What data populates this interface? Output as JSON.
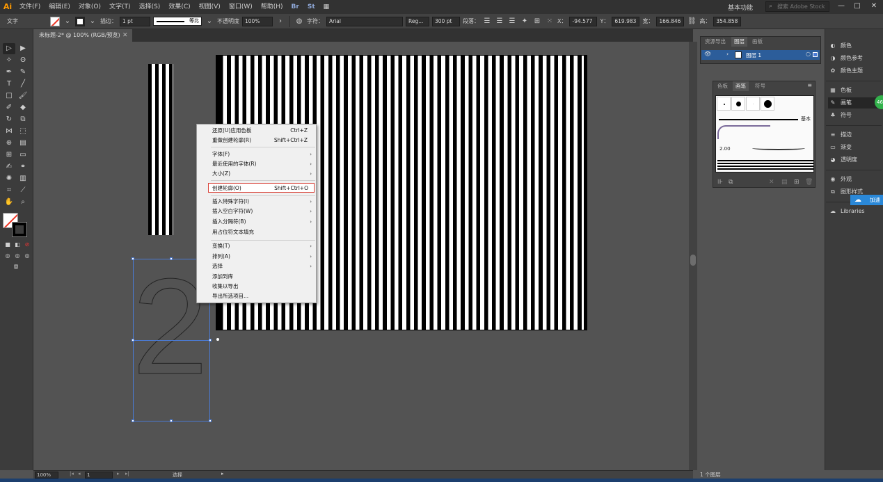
{
  "app": {
    "logo": "Ai"
  },
  "menubar": {
    "items": [
      "文件(F)",
      "编辑(E)",
      "对象(O)",
      "文字(T)",
      "选择(S)",
      "效果(C)",
      "视图(V)",
      "窗口(W)",
      "帮助(H)"
    ],
    "workspace": "基本功能",
    "stock_search_placeholder": "搜索 Adobe Stock",
    "window_buttons": [
      "—",
      "□",
      "✕"
    ]
  },
  "controlbar": {
    "tool_label": "文字",
    "stroke_label": "描边：",
    "stroke_weight": "1 pt",
    "stroke_profile": "等比",
    "opacity_label": "不透明度",
    "opacity_value": "100%",
    "char_label": "字符：",
    "font_family": "Arial",
    "font_style": "Reg...",
    "font_size": "300 pt",
    "para_label": "段落：",
    "x_label": "X：",
    "x_value": "-94.577",
    "y_label": "Y：",
    "y_value": "619.983",
    "w_label": "宽：",
    "w_value": "166.846",
    "h_label": "高：",
    "h_value": "354.858"
  },
  "document": {
    "tab_title": "未标题-2* @ 100% (RGB/预览)",
    "glyph": "2"
  },
  "context_menu": {
    "items": [
      {
        "label": "还原(U)应用色板",
        "shortcut": "Ctrl+Z"
      },
      {
        "label": "重做创建轮廓(R)",
        "shortcut": "Shift+Ctrl+Z"
      },
      {
        "label": "字体(F)",
        "submenu": "›"
      },
      {
        "label": "最近使用的字体(R)",
        "submenu": "›"
      },
      {
        "label": "大小(Z)",
        "submenu": "›"
      },
      {
        "label": "创建轮廓(O)",
        "shortcut": "Shift+Ctrl+O"
      },
      {
        "label": "插入特殊字符(I)",
        "submenu": "›"
      },
      {
        "label": "插入空白字符(W)",
        "submenu": "›"
      },
      {
        "label": "插入分隔符(B)",
        "submenu": "›"
      },
      {
        "label": "用占位符文本填充"
      },
      {
        "label": "变换(T)",
        "submenu": "›"
      },
      {
        "label": "排列(A)",
        "submenu": "›"
      },
      {
        "label": "选择",
        "submenu": "›"
      },
      {
        "label": "添加到库"
      },
      {
        "label": "收集以导出"
      },
      {
        "label": "导出所选项目..."
      }
    ]
  },
  "layers_panel": {
    "tabs": [
      "资源导出",
      "图层",
      "画板"
    ],
    "layer_name": "图层 1",
    "footer": "1 个图层"
  },
  "brush_panel": {
    "tabs": [
      "色板",
      "画笔",
      "符号"
    ],
    "basic_label": "基本",
    "size_label": "2.00"
  },
  "dock": {
    "items": [
      "颜色",
      "颜色参考",
      "颜色主题",
      "色板",
      "画笔",
      "符号",
      "描边",
      "渐变",
      "透明度",
      "外观",
      "图形样式",
      "Libraries"
    ],
    "badge": "46",
    "tip": "加速"
  },
  "statusbar": {
    "zoom": "100%",
    "artboard": "1",
    "tool": "选择"
  },
  "colors": {
    "accent_red": "#d9443a",
    "selection_blue": "#4a7bd6",
    "layer_highlight": "#2c5d9a",
    "badge_green": "#33b24c"
  }
}
